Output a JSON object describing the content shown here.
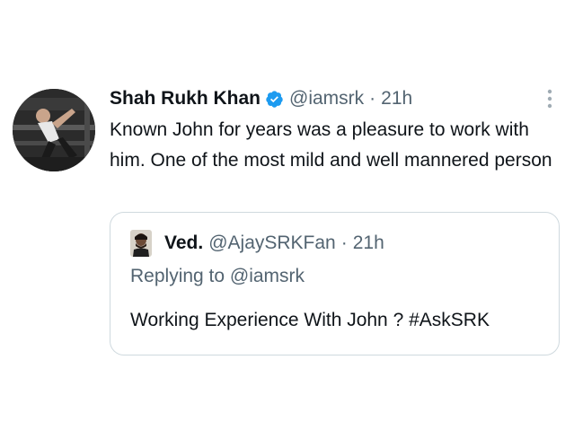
{
  "tweet": {
    "author_name": "Shah Rukh Khan",
    "handle": "@iamsrk",
    "separator": "·",
    "time": "21h",
    "text": "Known John for years was a pleasure to work with him. One of the most mild and well mannered person",
    "verified": true,
    "icons": {
      "verified": "verified-badge-icon",
      "more": "more-options-icon"
    },
    "colors": {
      "verified": "#1d9bf0",
      "secondary_text": "#536471",
      "primary_text": "#0f1419",
      "border": "#cfd9de"
    }
  },
  "quoted_tweet": {
    "author_name": "Ved.",
    "handle": "@AjaySRKFan",
    "separator": "·",
    "time": "21h",
    "reply_context": "Replying to @iamsrk",
    "text": "Working Experience With John ? #AskSRK"
  }
}
